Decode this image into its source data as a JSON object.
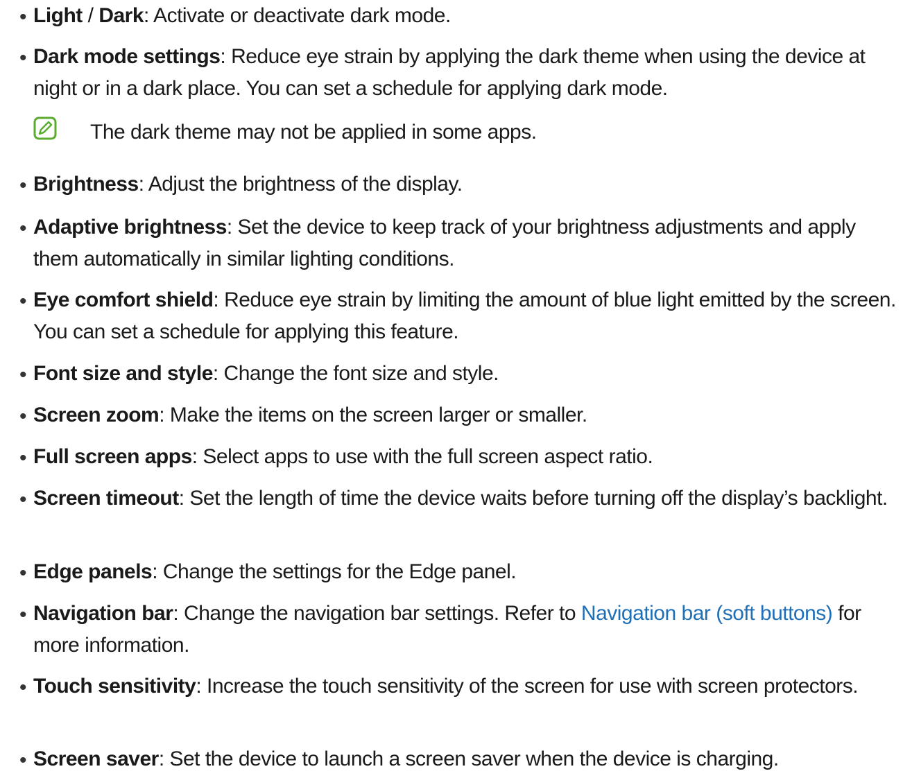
{
  "colors": {
    "link": "#1f6fb7",
    "note_icon": "#5aab2e"
  },
  "items": [
    {
      "bullet": "•",
      "term": "Light",
      "sep": " / ",
      "term2": "Dark",
      "desc": ": Activate or deactivate dark mode."
    },
    {
      "bullet": "•",
      "term": "Dark mode settings",
      "desc": ": Reduce eye strain by applying the dark theme when using the device at night or in a dark place. You can set a schedule for applying dark mode."
    },
    {
      "bullet": "•",
      "term": "Brightness",
      "desc": ": Adjust the brightness of the display."
    },
    {
      "bullet": "•",
      "term": "Adaptive brightness",
      "desc": ": Set the device to keep track of your brightness adjustments and apply them automatically in similar lighting conditions."
    },
    {
      "bullet": "•",
      "term": "Eye comfort shield",
      "desc": ": Reduce eye strain by limiting the amount of blue light emitted by the screen. You can set a schedule for applying this feature."
    },
    {
      "bullet": "•",
      "term": "Font size and style",
      "desc": ": Change the font size and style."
    },
    {
      "bullet": "•",
      "term": "Screen zoom",
      "desc": ": Make the items on the screen larger or smaller."
    },
    {
      "bullet": "•",
      "term": "Full screen apps",
      "desc": ": Select apps to use with the full screen aspect ratio."
    },
    {
      "bullet": "•",
      "term": "Screen timeout",
      "desc": ": Set the length of time the device waits before turning off the display’s backlight."
    },
    {
      "bullet": "•",
      "term": "Edge panels",
      "desc": ": Change the settings for the Edge panel."
    },
    {
      "bullet": "•",
      "term": "Navigation bar",
      "desc": ": Change the navigation bar settings. Refer to ",
      "link": "Navigation bar (soft buttons)",
      "desc_after": " for more information."
    },
    {
      "bullet": "•",
      "term": "Touch sensitivity",
      "desc": ": Increase the touch sensitivity of the screen for use with screen protectors."
    },
    {
      "bullet": "•",
      "term": "Screen saver",
      "desc": ": Set the device to launch a screen saver when the device is charging."
    }
  ],
  "note": {
    "icon": "note-pencil-icon",
    "text": "The dark theme may not be applied in some apps."
  }
}
